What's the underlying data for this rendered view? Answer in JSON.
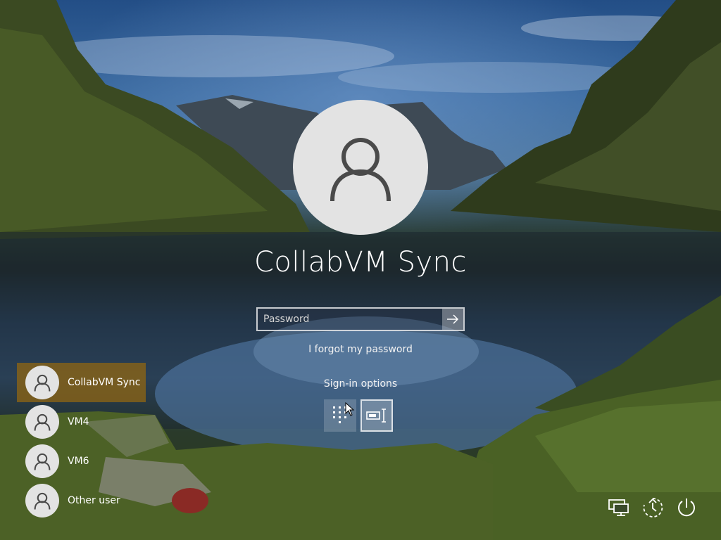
{
  "user": {
    "display_name": "CollabVM Sync"
  },
  "login": {
    "password_placeholder": "Password",
    "forgot_password_label": "I forgot my password",
    "signin_options_label": "Sign-in options"
  },
  "user_list": [
    {
      "name": "CollabVM Sync",
      "selected": true
    },
    {
      "name": "VM4",
      "selected": false
    },
    {
      "name": "VM6",
      "selected": false
    },
    {
      "name": "Other user",
      "selected": false
    }
  ],
  "icons": {
    "submit": "arrow-right-icon",
    "pin_option": "pin-keypad-icon",
    "password_option": "password-key-icon",
    "network": "network-icon",
    "ease_of_access": "ease-of-access-icon",
    "power": "power-icon"
  },
  "colors": {
    "selected_user_bg": "#8c6414",
    "avatar_bg": "#e3e3e3"
  }
}
